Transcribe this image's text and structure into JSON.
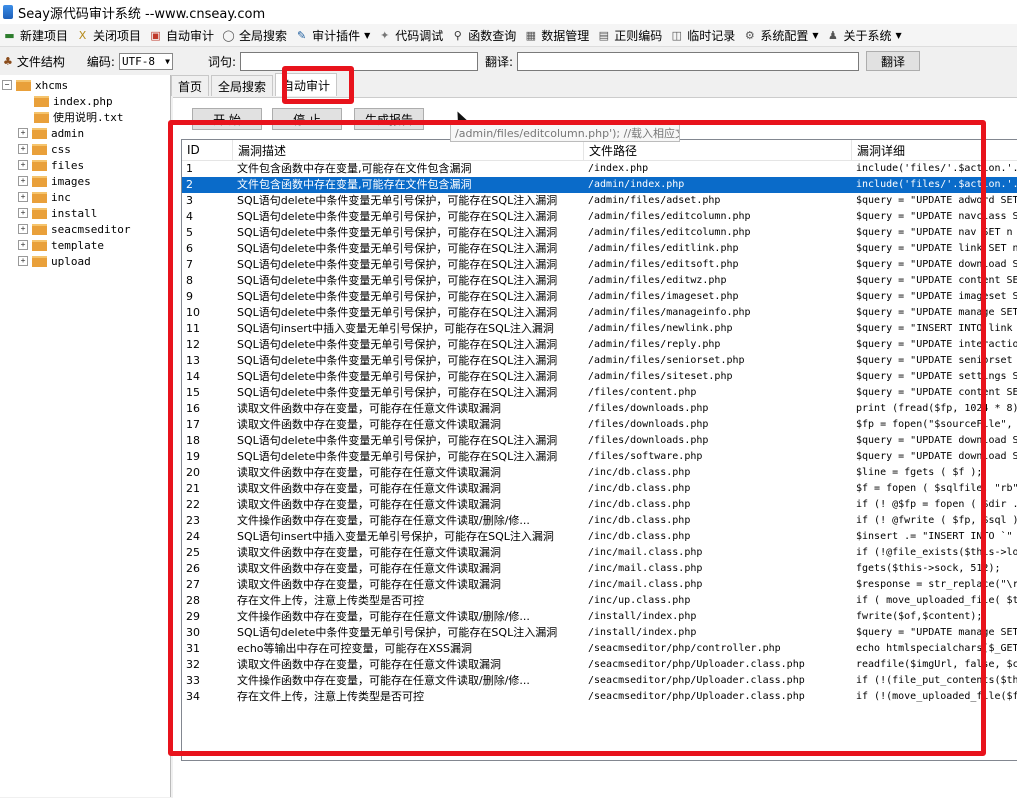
{
  "window": {
    "title": "Seay源代码审计系统 --www.cnseay.com"
  },
  "menu": [
    {
      "label": "新建项目",
      "icon": "new-project-icon",
      "glyph": "▬",
      "color": "#2d7d2d"
    },
    {
      "label": "关闭项目",
      "icon": "close-project-icon",
      "glyph": "X",
      "color": "#b58a1a"
    },
    {
      "label": "自动审计",
      "icon": "auto-audit-icon",
      "glyph": "▣",
      "color": "#c0392b"
    },
    {
      "label": "全局搜索",
      "icon": "global-search-icon",
      "glyph": "◯",
      "color": "#555"
    },
    {
      "label": "审计插件",
      "icon": "plugin-icon",
      "glyph": "✎",
      "color": "#2060a0",
      "dropdown": true
    },
    {
      "label": "代码调试",
      "icon": "debug-icon",
      "glyph": "✦",
      "color": "#777"
    },
    {
      "label": "函数查询",
      "icon": "function-search-icon",
      "glyph": "⚲",
      "color": "#333"
    },
    {
      "label": "数据管理",
      "icon": "data-manage-icon",
      "glyph": "▦",
      "color": "#555"
    },
    {
      "label": "正则编码",
      "icon": "regex-encode-icon",
      "glyph": "▤",
      "color": "#555"
    },
    {
      "label": "临时记录",
      "icon": "temp-record-icon",
      "glyph": "◫",
      "color": "#555"
    },
    {
      "label": "系统配置",
      "icon": "gear-icon",
      "glyph": "⚙",
      "color": "#555",
      "dropdown": true
    },
    {
      "label": "关于系统",
      "icon": "about-icon",
      "glyph": "♟",
      "color": "#555",
      "dropdown": true
    }
  ],
  "toolbar": {
    "file_structure": "文件结构",
    "encoding_label": "编码:",
    "encoding_value": "UTF-8",
    "word_label": "词句:",
    "word_value": "",
    "translate_label": "翻译:",
    "translate_value": "",
    "translate_button": "翻译"
  },
  "tree": {
    "root": "xhcms",
    "items": [
      {
        "label": "index.php",
        "type": "file"
      },
      {
        "label": "使用说明.txt",
        "type": "file"
      },
      {
        "label": "admin",
        "type": "folder"
      },
      {
        "label": "css",
        "type": "folder"
      },
      {
        "label": "files",
        "type": "folder"
      },
      {
        "label": "images",
        "type": "folder"
      },
      {
        "label": "inc",
        "type": "folder"
      },
      {
        "label": "install",
        "type": "folder"
      },
      {
        "label": "seacmseditor",
        "type": "folder"
      },
      {
        "label": "template",
        "type": "folder"
      },
      {
        "label": "upload",
        "type": "folder"
      }
    ]
  },
  "tabs": [
    "首页",
    "全局搜索",
    "自动审计"
  ],
  "active_tab": 2,
  "actions": {
    "start": "开 始",
    "stop": "停 止",
    "report": "生成报告"
  },
  "columns": [
    "ID",
    "漏洞描述",
    "文件路径",
    "漏洞详细"
  ],
  "selected_row": 1,
  "tooltip": "/admin/files/editcolumn.php'); //载入相应文件",
  "rows": [
    [
      "1",
      "文件包含函数中存在变量,可能存在文件包含漏洞",
      "/index.php",
      "include('files/'.$action.'."
    ],
    [
      "2",
      "文件包含函数中存在变量,可能存在文件包含漏洞",
      "/admin/index.php",
      "include('files/'.$action.'."
    ],
    [
      "3",
      "SQL语句delete中条件变量无单引号保护，可能存在SQL注入漏洞",
      "/admin/files/adset.php",
      "$query = \"UPDATE adword SET"
    ],
    [
      "4",
      "SQL语句delete中条件变量无单引号保护，可能存在SQL注入漏洞",
      "/admin/files/editcolumn.php",
      "$query = \"UPDATE navclass S"
    ],
    [
      "5",
      "SQL语句delete中条件变量无单引号保护，可能存在SQL注入漏洞",
      "/admin/files/editcolumn.php",
      "$query = \"UPDATE nav SET n"
    ],
    [
      "6",
      "SQL语句delete中条件变量无单引号保护，可能存在SQL注入漏洞",
      "/admin/files/editlink.php",
      "$query = \"UPDATE link SET n"
    ],
    [
      "7",
      "SQL语句delete中条件变量无单引号保护，可能存在SQL注入漏洞",
      "/admin/files/editsoft.php",
      "$query = \"UPDATE download S"
    ],
    [
      "8",
      "SQL语句delete中条件变量无单引号保护，可能存在SQL注入漏洞",
      "/admin/files/editwz.php",
      "$query = \"UPDATE content SE"
    ],
    [
      "9",
      "SQL语句delete中条件变量无单引号保护，可能存在SQL注入漏洞",
      "/admin/files/imageset.php",
      "$query = \"UPDATE imageset S"
    ],
    [
      "10",
      "SQL语句delete中条件变量无单引号保护，可能存在SQL注入漏洞",
      "/admin/files/manageinfo.php",
      "$query = \"UPDATE manage SET"
    ],
    [
      "11",
      "SQL语句insert中插入变量无单引号保护，可能存在SQL注入漏洞",
      "/admin/files/newlink.php",
      "$query = \"INSERT INTO link"
    ],
    [
      "12",
      "SQL语句delete中条件变量无单引号保护，可能存在SQL注入漏洞",
      "/admin/files/reply.php",
      "$query = \"UPDATE interactio"
    ],
    [
      "13",
      "SQL语句delete中条件变量无单引号保护，可能存在SQL注入漏洞",
      "/admin/files/seniorset.php",
      "$query = \"UPDATE seniorset"
    ],
    [
      "14",
      "SQL语句delete中条件变量无单引号保护，可能存在SQL注入漏洞",
      "/admin/files/siteset.php",
      "$query = \"UPDATE settings S"
    ],
    [
      "15",
      "SQL语句delete中条件变量无单引号保护，可能存在SQL注入漏洞",
      "/files/content.php",
      "$query = \"UPDATE content SE"
    ],
    [
      "16",
      "读取文件函数中存在变量，可能存在任意文件读取漏洞",
      "/files/downloads.php",
      "print (fread($fp, 1024 * 8))"
    ],
    [
      "17",
      "读取文件函数中存在变量，可能存在任意文件读取漏洞",
      "/files/downloads.php",
      "$fp = fopen(\"$sourceFile\","
    ],
    [
      "18",
      "SQL语句delete中条件变量无单引号保护，可能存在SQL注入漏洞",
      "/files/downloads.php",
      "$query = \"UPDATE download S"
    ],
    [
      "19",
      "SQL语句delete中条件变量无单引号保护，可能存在SQL注入漏洞",
      "/files/software.php",
      "$query = \"UPDATE download S"
    ],
    [
      "20",
      "读取文件函数中存在变量，可能存在任意文件读取漏洞",
      "/inc/db.class.php",
      "$line = fgets ( $f );"
    ],
    [
      "21",
      "读取文件函数中存在变量，可能存在任意文件读取漏洞",
      "/inc/db.class.php",
      "$f = fopen ( $sqlfile, \"rb\""
    ],
    [
      "22",
      "读取文件函数中存在变量，可能存在任意文件读取漏洞",
      "/inc/db.class.php",
      "if (! @$fp = fopen ( $dir ."
    ],
    [
      "23",
      "文件操作函数中存在变量，可能存在任意文件读取/删除/修...",
      "/inc/db.class.php",
      "if (! @fwrite ( $fp, $sql )"
    ],
    [
      "24",
      "SQL语句insert中插入变量无单引号保护，可能存在SQL注入漏洞",
      "/inc/db.class.php",
      "$insert .= \"INSERT INTO `\""
    ],
    [
      "25",
      "读取文件函数中存在变量，可能存在任意文件读取漏洞",
      "/inc/mail.class.php",
      "if (!@file_exists($this->lo"
    ],
    [
      "26",
      "读取文件函数中存在变量，可能存在任意文件读取漏洞",
      "/inc/mail.class.php",
      "fgets($this->sock, 512);"
    ],
    [
      "27",
      "读取文件函数中存在变量，可能存在任意文件读取漏洞",
      "/inc/mail.class.php",
      "$response = str_replace(\"\\r"
    ],
    [
      "28",
      "存在文件上传，注意上传类型是否可控",
      "/inc/up.class.php",
      "if ( move_uploaded_file( $t"
    ],
    [
      "29",
      "文件操作函数中存在变量，可能存在任意文件读取/删除/修...",
      "/install/index.php",
      "fwrite($of,$content);"
    ],
    [
      "30",
      "SQL语句delete中条件变量无单引号保护，可能存在SQL注入漏洞",
      "/install/index.php",
      "$query = \"UPDATE manage SET"
    ],
    [
      "31",
      "echo等输出中存在可控变量，可能存在XSS漏洞",
      "/seacmseditor/php/controller.php",
      "echo htmlspecialchars($_GET"
    ],
    [
      "32",
      "读取文件函数中存在变量，可能存在任意文件读取漏洞",
      "/seacmseditor/php/Uploader.class.php",
      "readfile($imgUrl, false, $c"
    ],
    [
      "33",
      "文件操作函数中存在变量，可能存在任意文件读取/删除/修...",
      "/seacmseditor/php/Uploader.class.php",
      "if (!(file_put_contents($th"
    ],
    [
      "34",
      "存在文件上传，注意上传类型是否可控",
      "/seacmseditor/php/Uploader.class.php",
      "if (!(move_uploaded_file($f"
    ]
  ]
}
